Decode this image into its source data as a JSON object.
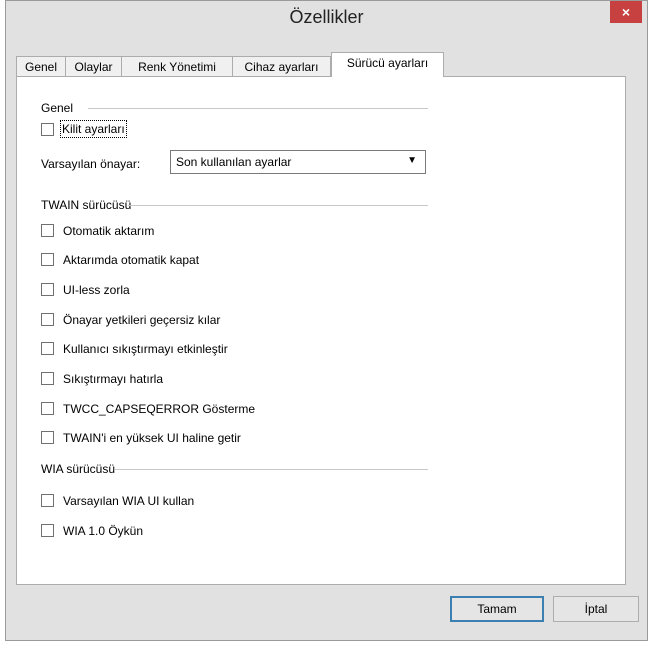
{
  "window": {
    "title": "Özellikler",
    "close_icon": "×"
  },
  "tabs": [
    {
      "label": "Genel"
    },
    {
      "label": "Olaylar"
    },
    {
      "label": "Renk Yönetimi"
    },
    {
      "label": "Cihaz ayarları"
    },
    {
      "label": "Sürücü ayarları",
      "active": true
    }
  ],
  "general": {
    "title": "Genel",
    "lock_label": "Kilit ayarları",
    "preset_label": "Varsayılan önayar:",
    "preset_value": "Son kullanılan ayarlar"
  },
  "twain": {
    "title": "TWAIN sürücüsü",
    "options": [
      "Otomatik aktarım",
      "Aktarımda otomatik kapat",
      "UI-less zorla",
      "Önayar yetkileri geçersiz kılar",
      "Kullanıcı sıkıştırmayı etkinleştir",
      "Sıkıştırmayı hatırla",
      "TWCC_CAPSEQERROR Gösterme",
      "TWAIN'i en yüksek UI haline getir"
    ]
  },
  "wia": {
    "title": "WIA sürücüsü",
    "options": [
      "Varsayılan WIA UI kullan",
      "WIA 1.0 Öykün"
    ]
  },
  "buttons": {
    "ok": "Tamam",
    "cancel": "İptal"
  }
}
